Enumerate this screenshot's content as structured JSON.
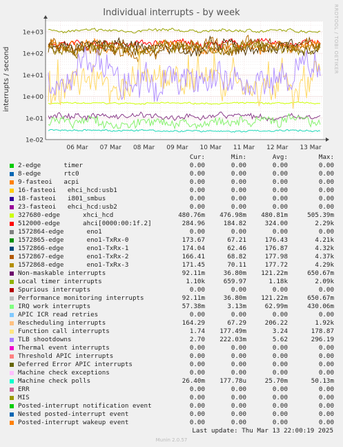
{
  "title": "Individual interrupts - by week",
  "side_label": "RRDTOOL / TOBI OETIKER",
  "chart_data": {
    "type": "line",
    "ylabel": "interrupts / second",
    "yscale": "log",
    "ylim": [
      0.01,
      3000
    ],
    "y_ticks": [
      {
        "label": "1e-02",
        "value": 0.01
      },
      {
        "label": "1e-01",
        "value": 0.1
      },
      {
        "label": "1e+00",
        "value": 1
      },
      {
        "label": "1e+01",
        "value": 10
      },
      {
        "label": "1e+02",
        "value": 100
      },
      {
        "label": "1e+03",
        "value": 1000
      }
    ],
    "x_ticks": [
      "06 Mar",
      "07 Mar",
      "08 Mar",
      "09 Mar",
      "10 Mar",
      "11 Mar",
      "12 Mar",
      "13 Mar"
    ],
    "grid": true,
    "series": [
      {
        "name": "327680-edge xhci_hcd",
        "color": "#ccff00",
        "base": 0.48,
        "spread": 0.05
      },
      {
        "name": "Local timer interrupts",
        "color": "#98a200",
        "base": 1100,
        "spread": 0.1
      },
      {
        "name": "512000-edge ahci[0000:00:1f.2]",
        "color": "#ff0000",
        "base": 285,
        "spread": 0.25
      },
      {
        "name": "Rescheduling interrupts",
        "color": "#ff8000",
        "base": 206,
        "spread": 0.35
      },
      {
        "name": "1572865-edge enol-TxRx-0",
        "color": "#4e3300",
        "base": 176,
        "spread": 0.45
      },
      {
        "name": "1572866-edge enol-TxRx-1",
        "color": "#7d5100",
        "base": 177,
        "spread": 0.45
      },
      {
        "name": "1572867-edge enol-TxRx-2",
        "color": "#b46c00",
        "base": 178,
        "spread": 0.45
      },
      {
        "name": "1572868-edge enol-TxRx-3",
        "color": "#9a7e00",
        "base": 178,
        "spread": 0.45
      },
      {
        "name": "Function call interrupts",
        "color": "#ffd966",
        "base": 3.24,
        "spread": 1.1
      },
      {
        "name": "TLB shootdowns",
        "color": "#b292ff",
        "base": 5.62,
        "spread": 1.2
      },
      {
        "name": "Non-maskable interrupts",
        "color": "#8a3d8a",
        "base": 0.121,
        "spread": 0.2
      },
      {
        "name": "IRQ work interrupts",
        "color": "#86f26e",
        "base": 0.063,
        "spread": 0.35
      },
      {
        "name": "Machine check polls",
        "color": "#1cd7b7",
        "base": 0.0257,
        "spread": 0.06
      }
    ]
  },
  "legend": {
    "headers": [
      "Cur:",
      "Min:",
      "Avg:",
      "Max:"
    ],
    "rows": [
      {
        "label": "2-edge      timer",
        "color": "#00cc00",
        "cur": "0.00",
        "min": "0.00",
        "avg": "0.00",
        "max": "0.00"
      },
      {
        "label": "8-edge      rtc0",
        "color": "#0066b3",
        "cur": "0.00",
        "min": "0.00",
        "avg": "0.00",
        "max": "0.00"
      },
      {
        "label": "9-fasteoi   acpi",
        "color": "#ff8000",
        "cur": "0.00",
        "min": "0.00",
        "avg": "0.00",
        "max": "0.00"
      },
      {
        "label": "16-fasteoi   ehci_hcd:usb1",
        "color": "#ffcc00",
        "cur": "0.00",
        "min": "0.00",
        "avg": "0.00",
        "max": "0.00"
      },
      {
        "label": "18-fasteoi   i801_smbus",
        "color": "#330099",
        "cur": "0.00",
        "min": "0.00",
        "avg": "0.00",
        "max": "0.00"
      },
      {
        "label": "23-fasteoi   ehci_hcd:usb2",
        "color": "#990099",
        "cur": "0.00",
        "min": "0.00",
        "avg": "0.00",
        "max": "0.00"
      },
      {
        "label": "327680-edge      xhci_hcd",
        "color": "#ccff00",
        "cur": "480.76m",
        "min": "476.98m",
        "avg": "480.81m",
        "max": "505.39m"
      },
      {
        "label": "512000-edge      ahci[0000:00:1f.2]",
        "color": "#ff0000",
        "cur": "284.96",
        "min": "184.82",
        "avg": "324.00",
        "max": "2.29k"
      },
      {
        "label": "1572864-edge      eno1",
        "color": "#808080",
        "cur": "0.00",
        "min": "0.00",
        "avg": "0.00",
        "max": "0.00"
      },
      {
        "label": "1572865-edge      eno1-TxRx-0",
        "color": "#008f00",
        "cur": "173.67",
        "min": "67.21",
        "avg": "176.43",
        "max": "4.21k"
      },
      {
        "label": "1572866-edge      eno1-TxRx-1",
        "color": "#00487d",
        "cur": "174.04",
        "min": "62.46",
        "avg": "176.87",
        "max": "4.32k"
      },
      {
        "label": "1572867-edge      eno1-TxRx-2",
        "color": "#b35a00",
        "cur": "166.41",
        "min": "68.82",
        "avg": "177.98",
        "max": "4.37k"
      },
      {
        "label": "1572868-edge      eno1-TxRx-3",
        "color": "#b38f00",
        "cur": "171.45",
        "min": "70.11",
        "avg": "177.72",
        "max": "4.29k"
      },
      {
        "label": "Non-maskable interrupts",
        "color": "#6b006b",
        "cur": "92.11m",
        "min": "36.80m",
        "avg": "121.22m",
        "max": "650.67m"
      },
      {
        "label": "Local timer interrupts",
        "color": "#8fb300",
        "cur": "1.10k",
        "min": "659.97",
        "avg": "1.18k",
        "max": "2.09k"
      },
      {
        "label": "Spurious interrupts",
        "color": "#b30000",
        "cur": "0.00",
        "min": "0.00",
        "avg": "0.00",
        "max": "0.00"
      },
      {
        "label": "Performance monitoring interrupts",
        "color": "#bebebe",
        "cur": "92.11m",
        "min": "36.80m",
        "avg": "121.22m",
        "max": "650.67m"
      },
      {
        "label": "IRQ work interrupts",
        "color": "#80ff80",
        "cur": "57.38m",
        "min": "3.13m",
        "avg": "62.99m",
        "max": "430.06m"
      },
      {
        "label": "APIC ICR read retries",
        "color": "#80c9ff",
        "cur": "0.00",
        "min": "0.00",
        "avg": "0.00",
        "max": "0.00"
      },
      {
        "label": "Rescheduling interrupts",
        "color": "#ffc080",
        "cur": "164.29",
        "min": "67.29",
        "avg": "206.22",
        "max": "1.92k"
      },
      {
        "label": "Function call interrupts",
        "color": "#ffe680",
        "cur": "1.74",
        "min": "177.49m",
        "avg": "3.24",
        "max": "178.87"
      },
      {
        "label": "TLB shootdowns",
        "color": "#aa80ff",
        "cur": "2.70",
        "min": "222.03m",
        "avg": "5.62",
        "max": "296.19"
      },
      {
        "label": "Thermal event interrupts",
        "color": "#ee00cc",
        "cur": "0.00",
        "min": "0.00",
        "avg": "0.00",
        "max": "0.00"
      },
      {
        "label": "Threshold APIC interrupts",
        "color": "#ff8080",
        "cur": "0.00",
        "min": "0.00",
        "avg": "0.00",
        "max": "0.00"
      },
      {
        "label": "Deferred Error APIC interrupts",
        "color": "#666600",
        "cur": "0.00",
        "min": "0.00",
        "avg": "0.00",
        "max": "0.00"
      },
      {
        "label": "Machine check exceptions",
        "color": "#ffbfff",
        "cur": "0.00",
        "min": "0.00",
        "avg": "0.00",
        "max": "0.00"
      },
      {
        "label": "Machine check polls",
        "color": "#00ffcc",
        "cur": "26.40m",
        "min": "177.78u",
        "avg": "25.70m",
        "max": "50.13m"
      },
      {
        "label": "ERR",
        "color": "#cc6699",
        "cur": "0.00",
        "min": "0.00",
        "avg": "0.00",
        "max": "0.00"
      },
      {
        "label": "MIS",
        "color": "#999900",
        "cur": "0.00",
        "min": "0.00",
        "avg": "0.00",
        "max": "0.00"
      },
      {
        "label": "Posted-interrupt notification event",
        "color": "#00cc00",
        "cur": "0.00",
        "min": "0.00",
        "avg": "0.00",
        "max": "0.00"
      },
      {
        "label": "Nested posted-interrupt event",
        "color": "#0066b3",
        "cur": "0.00",
        "min": "0.00",
        "avg": "0.00",
        "max": "0.00"
      },
      {
        "label": "Posted-interrupt wakeup event",
        "color": "#ff8000",
        "cur": "0.00",
        "min": "0.00",
        "avg": "0.00",
        "max": "0.00"
      }
    ]
  },
  "last_update": "Last update: Thu Mar 13 22:00:19 2025",
  "munin_version": "Munin 2.0.57"
}
